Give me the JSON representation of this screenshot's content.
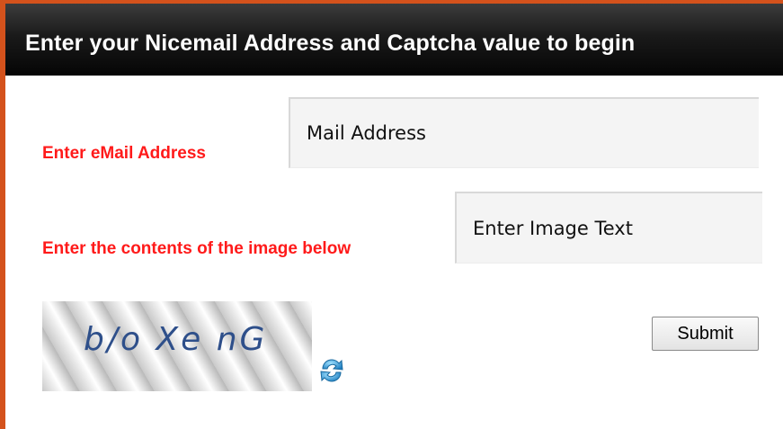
{
  "header": {
    "title": "Enter your Nicemail Address and Captcha value to begin"
  },
  "form": {
    "email_label": "Enter eMail Address",
    "email_placeholder": "Mail Address",
    "captcha_label": "Enter the contents of the image below",
    "captcha_placeholder": "Enter Image Text",
    "captcha_image_text": "b/o Xe nG",
    "submit_label": "Submit"
  },
  "icons": {
    "refresh": "refresh-icon"
  },
  "colors": {
    "accent_border": "#d4521c",
    "label_red": "#ff1a1a",
    "header_bg": "#111111",
    "captcha_text": "#2e4f8a",
    "refresh_blue": "#3aa0d8"
  }
}
